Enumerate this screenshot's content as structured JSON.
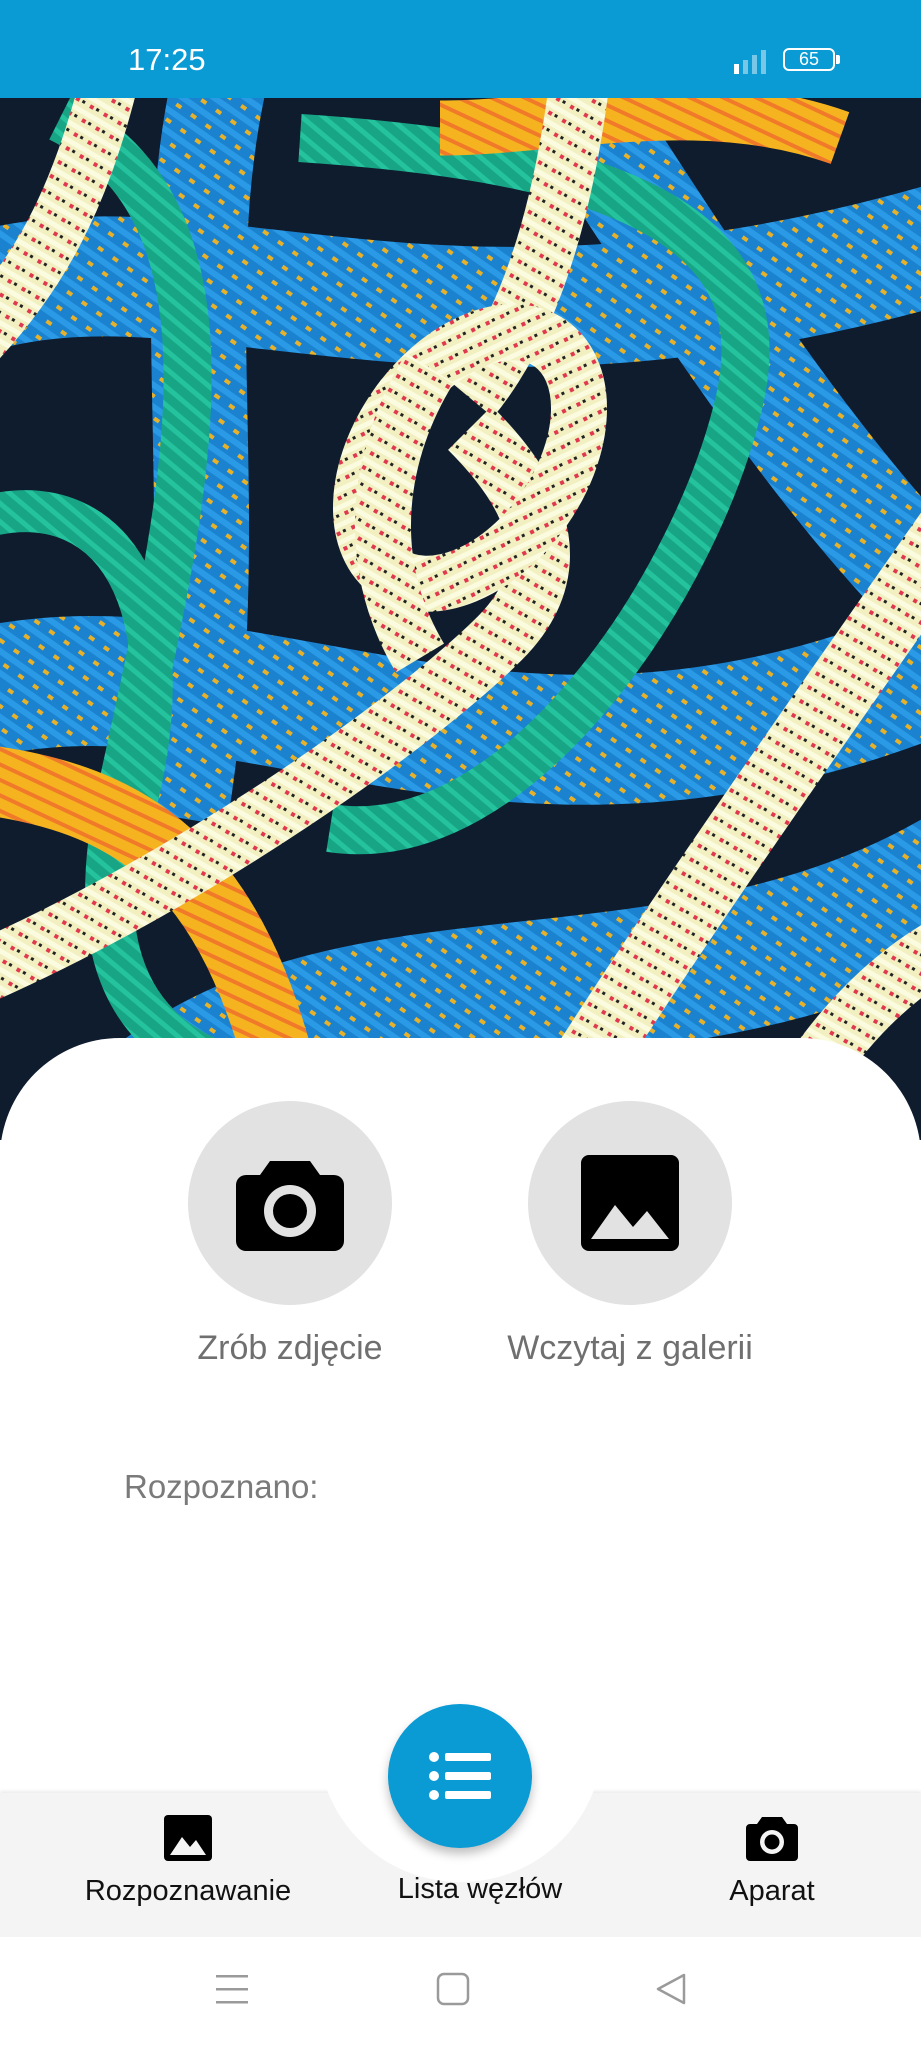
{
  "status_bar": {
    "time": "17:25",
    "battery_level": "65",
    "background_color": "#0a9ad4"
  },
  "hero": {
    "icon": "rope-knot-photo"
  },
  "actions": {
    "take_photo": {
      "label": "Zrób zdjęcie",
      "icon": "camera-icon"
    },
    "load_gallery": {
      "label": "Wczytaj z galerii",
      "icon": "image-icon"
    }
  },
  "result": {
    "label": "Rozpoznano:"
  },
  "bottom_nav": {
    "items": [
      {
        "label": "Rozpoznawanie",
        "icon": "image-icon"
      },
      {
        "label": "Lista węzłów",
        "icon": "list-icon"
      },
      {
        "label": "Aparat",
        "icon": "camera-icon"
      }
    ],
    "accent_color": "#0a9ad4"
  },
  "system_nav": {
    "buttons": [
      "menu-icon",
      "home-icon",
      "back-icon"
    ]
  }
}
